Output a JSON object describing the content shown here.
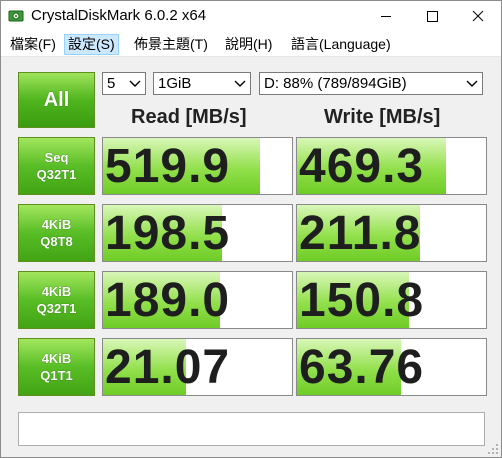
{
  "window": {
    "title": "CrystalDiskMark 6.0.2 x64",
    "icons": {
      "app": "disk-icon",
      "minimize": "minimize-icon",
      "maximize": "maximize-icon",
      "close": "close-icon"
    }
  },
  "menu": {
    "items": [
      {
        "label": "檔案(F)"
      },
      {
        "label": "設定(S)",
        "active": true
      },
      {
        "label": "佈景主題(T)"
      },
      {
        "label": "說明(H)"
      },
      {
        "label": "語言(Language)"
      }
    ]
  },
  "controls": {
    "all_label": "All",
    "count": "5",
    "size": "1GiB",
    "drive": "D: 88% (789/894GiB)"
  },
  "columns": {
    "read": "Read [MB/s]",
    "write": "Write [MB/s]"
  },
  "results": [
    {
      "line1": "Seq",
      "line2": "Q32T1",
      "read": "519.9",
      "write": "469.3",
      "read_fill": 0.83,
      "write_fill": 0.79
    },
    {
      "line1": "4KiB",
      "line2": "Q8T8",
      "read": "198.5",
      "write": "211.8",
      "read_fill": 0.63,
      "write_fill": 0.65
    },
    {
      "line1": "4KiB",
      "line2": "Q32T1",
      "read": "189.0",
      "write": "150.8",
      "read_fill": 0.62,
      "write_fill": 0.59
    },
    {
      "line1": "4KiB",
      "line2": "Q1T1",
      "read": "21.07",
      "write": "63.76",
      "read_fill": 0.44,
      "write_fill": 0.55
    }
  ],
  "comment": "",
  "colors": {
    "accent_green": "#4fb51e",
    "bar_green": "#92e04c"
  }
}
